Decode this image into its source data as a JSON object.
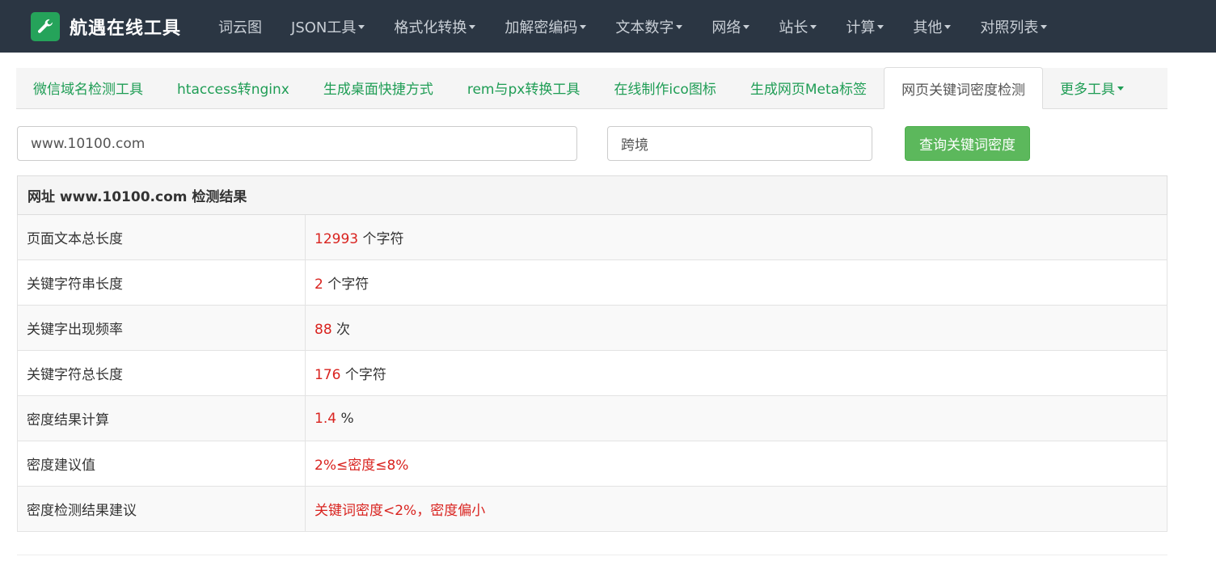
{
  "brand": {
    "title": "航遇在线工具",
    "icon": "wrench-icon",
    "accent": "#25a35a"
  },
  "nav": {
    "items": [
      {
        "label": "词云图",
        "dropdown": false
      },
      {
        "label": "JSON工具",
        "dropdown": true
      },
      {
        "label": "格式化转换",
        "dropdown": true
      },
      {
        "label": "加解密编码",
        "dropdown": true
      },
      {
        "label": "文本数字",
        "dropdown": true
      },
      {
        "label": "网络",
        "dropdown": true
      },
      {
        "label": "站长",
        "dropdown": true
      },
      {
        "label": "计算",
        "dropdown": true
      },
      {
        "label": "其他",
        "dropdown": true
      },
      {
        "label": "对照列表",
        "dropdown": true
      }
    ]
  },
  "tabs": [
    {
      "label": "微信域名检测工具",
      "active": false
    },
    {
      "label": "htaccess转nginx",
      "active": false
    },
    {
      "label": "生成桌面快捷方式",
      "active": false
    },
    {
      "label": "rem与px转换工具",
      "active": false
    },
    {
      "label": "在线制作ico图标",
      "active": false
    },
    {
      "label": "生成网页Meta标签",
      "active": false
    },
    {
      "label": "网页关键词密度检测",
      "active": true
    },
    {
      "label": "更多工具",
      "active": false,
      "dropdown": true
    }
  ],
  "form": {
    "url_value": "www.10100.com",
    "keyword_value": "跨境",
    "submit_label": "查询关键词密度"
  },
  "result": {
    "header": "网址 www.10100.com 检测结果",
    "rows": [
      {
        "label": "页面文本总长度",
        "value": "12993",
        "unit": " 个字符"
      },
      {
        "label": "关键字符串长度",
        "value": "2",
        "unit": " 个字符"
      },
      {
        "label": "关键字出现频率",
        "value": "88",
        "unit": " 次"
      },
      {
        "label": "关键字符总长度",
        "value": "176",
        "unit": " 个字符"
      },
      {
        "label": "密度结果计算",
        "value": "1.4",
        "unit": " %"
      },
      {
        "label": "密度建议值",
        "value": "2%≤密度≤8%",
        "unit": ""
      },
      {
        "label": "密度检测结果建议",
        "value": "关键词密度<2%，密度偏小",
        "unit": ""
      }
    ]
  },
  "colors": {
    "navbar": "#2b3643",
    "tab_link": "#1f9d55",
    "button": "#5cb85c",
    "highlight": "#d9231f"
  }
}
